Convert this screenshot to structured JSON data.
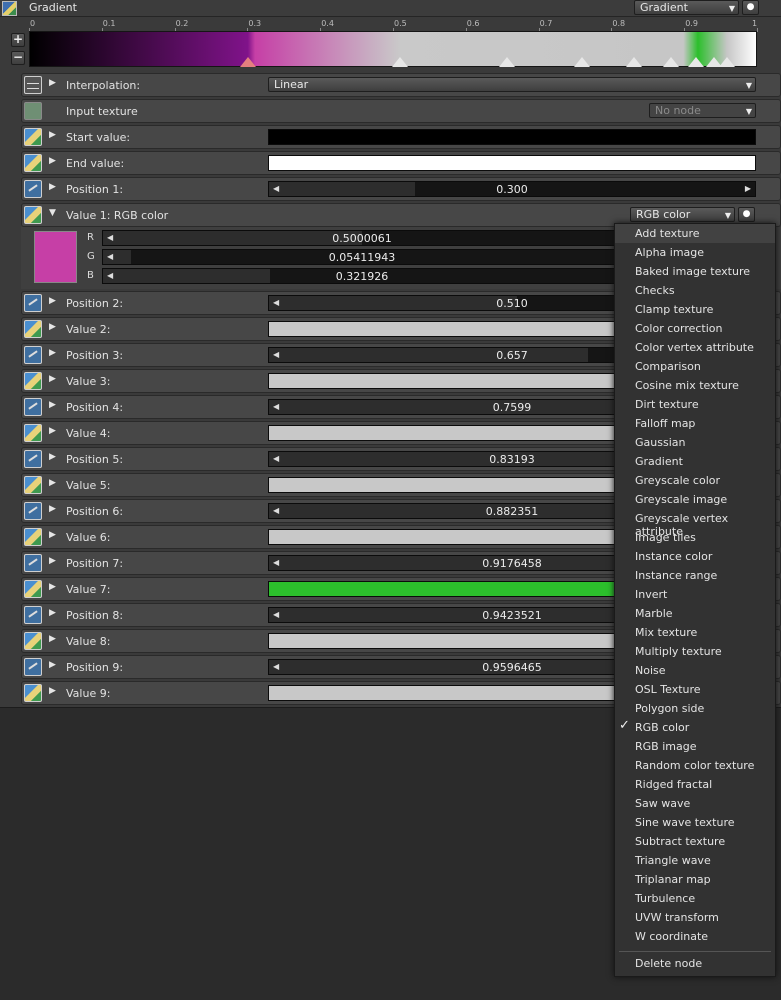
{
  "header": {
    "title": "Gradient",
    "type_select": "Gradient"
  },
  "ruler_ticks": [
    "0",
    "0.1",
    "0.2",
    "0.3",
    "0.4",
    "0.5",
    "0.6",
    "0.7",
    "0.8",
    "0.9",
    "1"
  ],
  "side_buttons": {
    "add": "+",
    "remove": "−"
  },
  "gradient_stops": [
    0.3,
    0.51,
    0.657,
    0.7599,
    0.83193,
    0.882351,
    0.9176458,
    0.9423521,
    0.9596465
  ],
  "active_stop": 0.3,
  "rows": {
    "interpolation": {
      "label": "Interpolation:",
      "value": "Linear"
    },
    "input_texture": {
      "label": "Input texture",
      "value": "No node"
    },
    "start_value": {
      "label": "Start value:",
      "color": "#000000"
    },
    "end_value": {
      "label": "End value:",
      "color": "#ffffff"
    },
    "position1": {
      "label": "Position 1:",
      "value": "0.300"
    },
    "value1": {
      "label": "Value 1: RGB color",
      "type": "RGB color"
    },
    "position2": {
      "label": "Position 2:",
      "value": "0.510"
    },
    "value2": {
      "label": "Value 2:",
      "color": "#c8c8c8"
    },
    "position3": {
      "label": "Position 3:",
      "value": "0.657"
    },
    "value3": {
      "label": "Value 3:",
      "color": "#c8c8c8"
    },
    "position4": {
      "label": "Position 4:",
      "value": "0.7599"
    },
    "value4": {
      "label": "Value 4:",
      "color": "#c8c8c8"
    },
    "position5": {
      "label": "Position 5:",
      "value": "0.83193"
    },
    "value5": {
      "label": "Value 5:",
      "color": "#c8c8c8"
    },
    "position6": {
      "label": "Position 6:",
      "value": "0.882351"
    },
    "value6": {
      "label": "Value 6:",
      "color": "#c8c8c8"
    },
    "position7": {
      "label": "Position 7:",
      "value": "0.9176458"
    },
    "value7": {
      "label": "Value 7:",
      "color": "#2cbf2c"
    },
    "position8": {
      "label": "Position 8:",
      "value": "0.9423521"
    },
    "value8": {
      "label": "Value 8:",
      "color": "#c8c8c8"
    },
    "position9": {
      "label": "Position 9:",
      "value": "0.9596465"
    },
    "value9": {
      "label": "Value 9:",
      "color": "#c8c8c8"
    }
  },
  "rgb": {
    "swatch_color": "#c63fa6",
    "r": {
      "label": "R",
      "value": "0.5000061"
    },
    "g": {
      "label": "G",
      "value": "0.05411943"
    },
    "b": {
      "label": "B",
      "value": "0.321926"
    }
  },
  "menu": {
    "items": [
      "Add texture",
      "Alpha image",
      "Baked image texture",
      "Checks",
      "Clamp texture",
      "Color correction",
      "Color vertex attribute",
      "Comparison",
      "Cosine mix texture",
      "Dirt texture",
      "Falloff map",
      "Gaussian",
      "Gradient",
      "Greyscale color",
      "Greyscale image",
      "Greyscale vertex attribute",
      "Image tiles",
      "Instance color",
      "Instance range",
      "Invert",
      "Marble",
      "Mix texture",
      "Multiply texture",
      "Noise",
      "OSL Texture",
      "Polygon side",
      "RGB color",
      "RGB image",
      "Random color texture",
      "Ridged fractal",
      "Saw wave",
      "Sine wave texture",
      "Subtract texture",
      "Triangle wave",
      "Triplanar map",
      "Turbulence",
      "UVW transform",
      "W coordinate"
    ],
    "checked": "RGB color",
    "delete": "Delete node",
    "check_glyph": "✓"
  }
}
